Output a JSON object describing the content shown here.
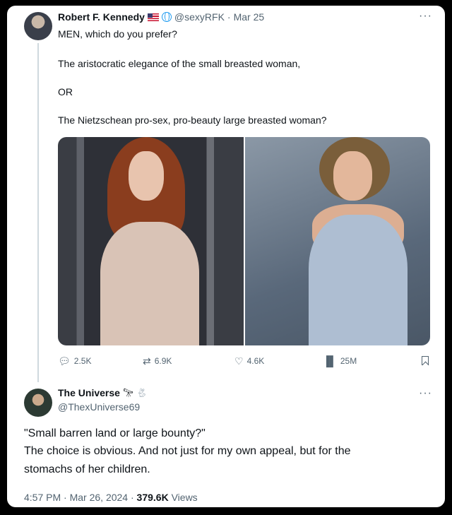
{
  "tweet1": {
    "author_name": "Robert F. Kennedy",
    "handle": "@sexyRFK",
    "separator": "·",
    "date": "Mar 25",
    "lines": [
      "MEN, which do you prefer?",
      "The aristocratic elegance of the small breasted woman,",
      "OR",
      "The Nietzschean pro-sex, pro-beauty large breasted woman?"
    ],
    "actions": {
      "replies": "2.5K",
      "reposts": "6.9K",
      "likes": "4.6K",
      "views": "25M"
    },
    "icons": [
      "reply-icon",
      "repost-icon",
      "like-icon",
      "views-icon",
      "bookmark-icon",
      "more-icon"
    ]
  },
  "tweet2": {
    "author_name": "The Universe",
    "handle": "@ThexUniverse69",
    "lines": [
      "\"Small barren land or large bounty?\"",
      "The choice is obvious.  And not just for my own appeal, but for the",
      "stomachs of her children."
    ],
    "time": "4:57 PM",
    "date": "Mar 26, 2024",
    "views_count": "379.6K",
    "views_label": "Views"
  },
  "colors": {
    "text": "#0f1419",
    "muted": "#536471",
    "accent": "#1d9bf0"
  }
}
